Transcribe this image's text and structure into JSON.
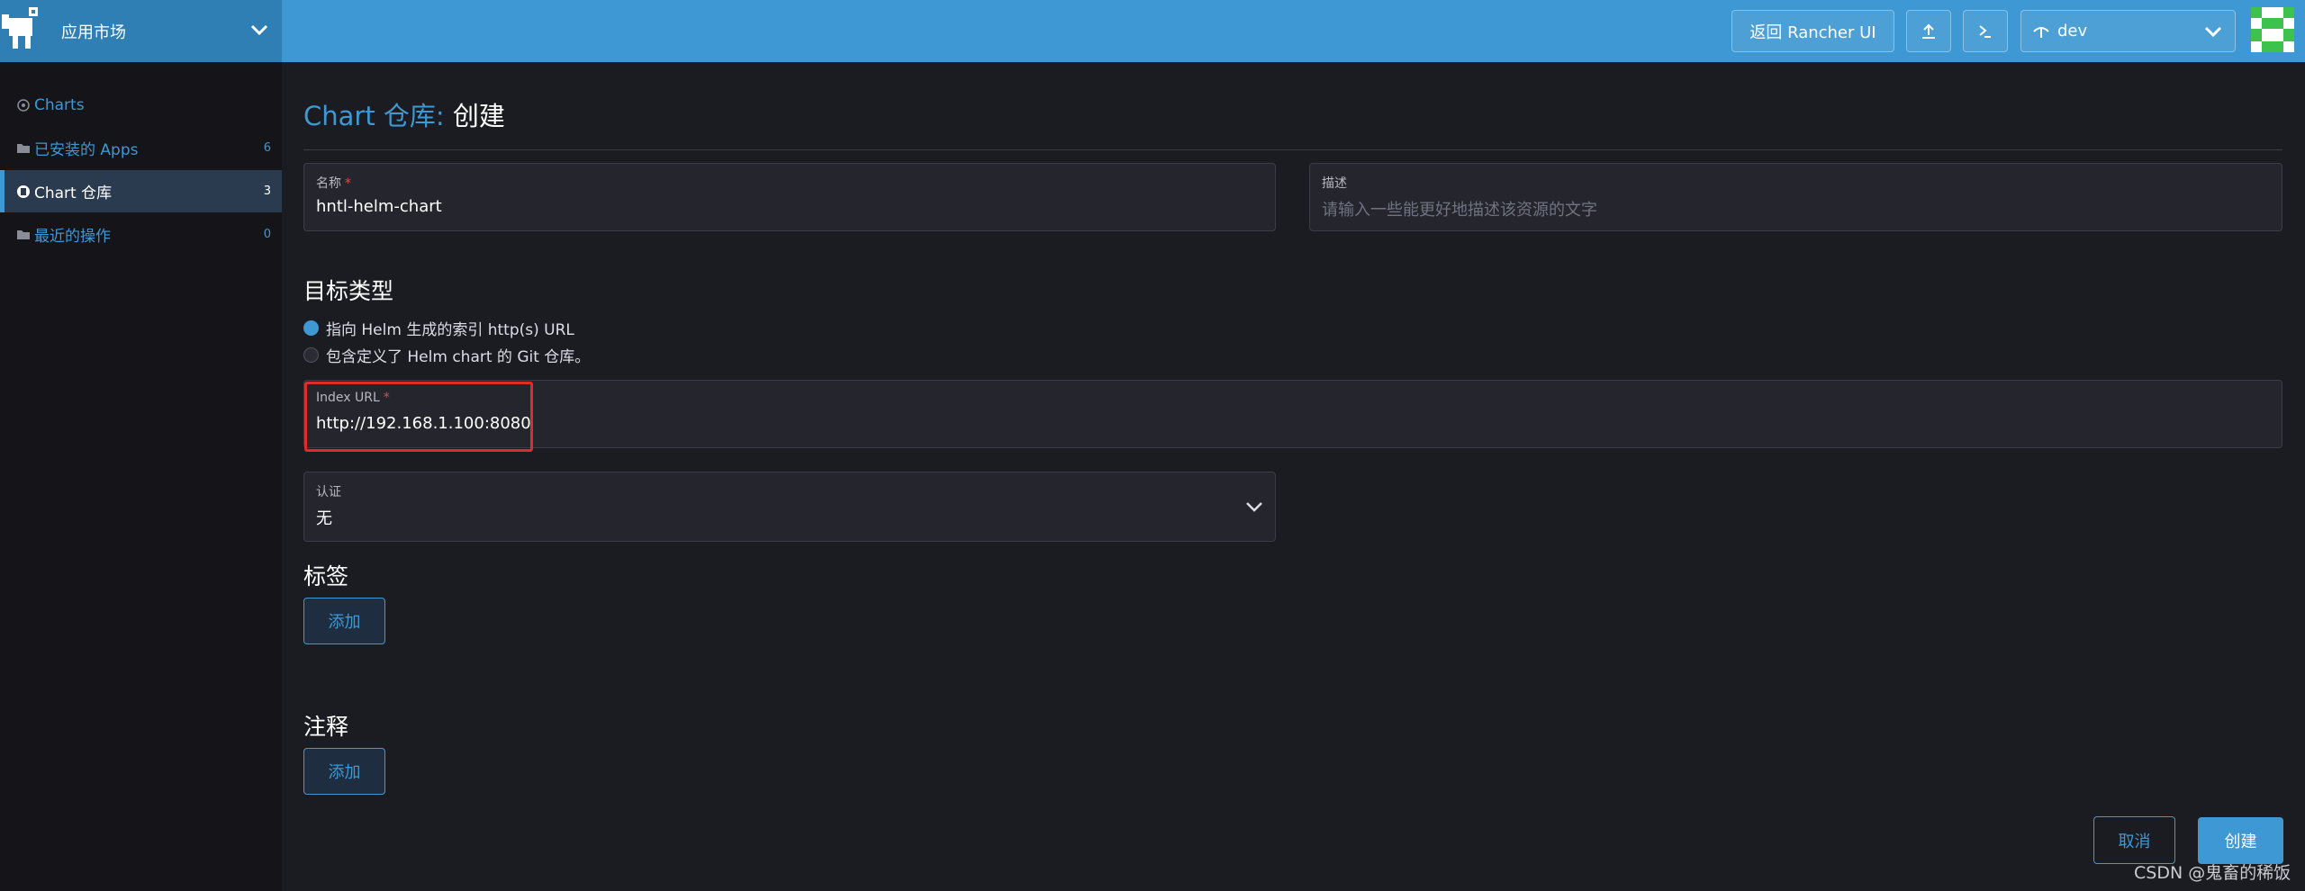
{
  "header": {
    "brand_title": "应用市场",
    "rancher_button": "返回 Rancher UI",
    "namespace": "dev",
    "colors": {
      "primary": "#3d98d3",
      "brand_bg": "#2f7eb4"
    },
    "icons": [
      "rancher-logo",
      "chevron-down-icon",
      "upload-icon",
      "shell-icon",
      "namespace-icon",
      "avatar"
    ]
  },
  "sidebar": {
    "items": [
      {
        "label": "Charts",
        "count": "",
        "icon": "target-icon"
      },
      {
        "label": "已安装的 Apps",
        "count": "6",
        "icon": "folder-icon"
      },
      {
        "label": "Chart 仓库",
        "count": "3",
        "icon": "repo-icon"
      },
      {
        "label": "最近的操作",
        "count": "0",
        "icon": "folder-icon"
      }
    ],
    "active": "Chart 仓库"
  },
  "page": {
    "crumb": "Chart 仓库:",
    "title": "创建"
  },
  "form": {
    "name_label": "名称",
    "name_value": "hntl-helm-chart",
    "required_mark": "*",
    "desc_label": "描述",
    "desc_placeholder": "请输入一些能更好地描述该资源的文字",
    "target_title": "目标类型",
    "radio_http": "指向 Helm 生成的索引 http(s) URL",
    "radio_git": "包含定义了 Helm chart 的 Git 仓库。",
    "index_label": "Index URL",
    "index_value": "http://192.168.1.100:8080",
    "auth_label": "认证",
    "auth_value": "无",
    "labels_title": "标签",
    "labels_add": "添加",
    "annot_title": "注释",
    "annot_add": "添加"
  },
  "footer": {
    "cancel": "取消",
    "create": "创建"
  },
  "watermark": "CSDN @鬼畜的稀饭"
}
